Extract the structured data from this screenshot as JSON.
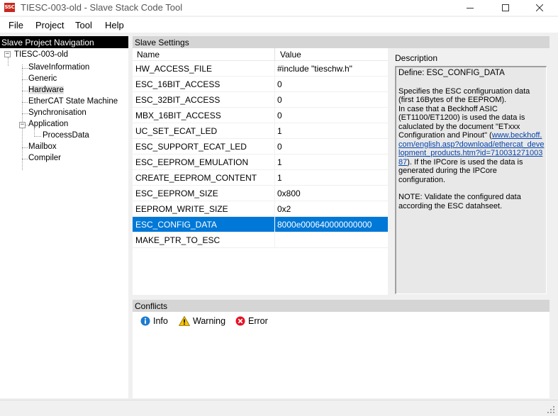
{
  "window": {
    "title": "TIESC-003-old - Slave Stack Code Tool",
    "icon_label": "SSC"
  },
  "menu": {
    "items": [
      "File",
      "Project",
      "Tool",
      "Help"
    ]
  },
  "navigation": {
    "header": "Slave Project Navigation",
    "root": "TIESC-003-old",
    "items": {
      "slave_information": "SlaveInformation",
      "generic": "Generic",
      "hardware": "Hardware",
      "ethercat_state_machine": "EtherCAT State Machine",
      "synchronisation": "Synchronisation",
      "application": "Application",
      "process_data": "ProcessData",
      "mailbox": "Mailbox",
      "compiler": "Compiler"
    },
    "selected": "Hardware"
  },
  "settings": {
    "header": "Slave Settings",
    "columns": {
      "name": "Name",
      "value": "Value"
    },
    "rows": [
      {
        "name": "HW_ACCESS_FILE",
        "value": "#include \"tieschw.h\""
      },
      {
        "name": "ESC_16BIT_ACCESS",
        "value": "0"
      },
      {
        "name": "ESC_32BIT_ACCESS",
        "value": "0"
      },
      {
        "name": "MBX_16BIT_ACCESS",
        "value": "0"
      },
      {
        "name": "UC_SET_ECAT_LED",
        "value": "1"
      },
      {
        "name": "ESC_SUPPORT_ECAT_LED",
        "value": "0"
      },
      {
        "name": "ESC_EEPROM_EMULATION",
        "value": "1"
      },
      {
        "name": "CREATE_EEPROM_CONTENT",
        "value": "1"
      },
      {
        "name": "ESC_EEPROM_SIZE",
        "value": "0x800"
      },
      {
        "name": "EEPROM_WRITE_SIZE",
        "value": "0x2"
      },
      {
        "name": "ESC_CONFIG_DATA",
        "value": "8000e000640000000000"
      },
      {
        "name": "MAKE_PTR_TO_ESC",
        "value": ""
      }
    ],
    "selected_row": "ESC_CONFIG_DATA"
  },
  "description": {
    "title": "Description",
    "define": "Define: ESC_CONFIG_DATA",
    "text_1": "Specifies the ESC configuruation data (first 16Bytes of the EEPROM).",
    "text_2": "In case that a Beckhoff ASIC (ET1100/ET1200) is used the data is caluclated by the document \"ETxxx Configuration and Pinout\" (",
    "link": "www.beckhoff.com/english.asp?download/ethercat_development_products.htm?id=71003127100387",
    "text_3": "). If the IPCore is used the data is generated during the IPCore configuration.",
    "note": "NOTE: Validate the configured data according the ESC datahseet."
  },
  "conflicts": {
    "header": "Conflicts",
    "buttons": {
      "info": "Info",
      "warning": "Warning",
      "error": "Error"
    }
  },
  "colors": {
    "selection": "#0078d7",
    "nav_header": "#000000",
    "panel_header": "#d5d5d5",
    "error_red": "#e81123",
    "warning_yellow": "#f5c400",
    "info_blue": "#1e7bd0"
  }
}
